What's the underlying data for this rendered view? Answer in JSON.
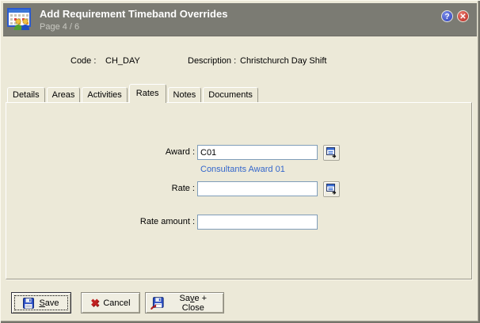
{
  "window": {
    "title": "Add Requirement Timeband Overrides",
    "subtitle": "Page 4 / 6",
    "help_glyph": "?",
    "close_glyph": "✕"
  },
  "header_fields": {
    "code_label": "Code :",
    "code_value": "CH_DAY",
    "description_label": "Description :",
    "description_value": "Christchurch Day Shift"
  },
  "tabs": {
    "active": "Rates",
    "items": [
      {
        "label": "Details"
      },
      {
        "label": "Areas"
      },
      {
        "label": "Activities"
      },
      {
        "label": "Rates"
      },
      {
        "label": "Notes"
      },
      {
        "label": "Documents"
      }
    ]
  },
  "form": {
    "award_label": "Award :",
    "award_value": "C01",
    "award_helper": "Consultants Award 01",
    "rate_label": "Rate :",
    "rate_value": "",
    "rate_amount_label": "Rate amount :",
    "rate_amount_value": ""
  },
  "buttons": {
    "save": {
      "pre": "",
      "key": "S",
      "rest": "ave"
    },
    "cancel": {
      "label": "Cancel"
    },
    "save_close": {
      "pre": "Sa",
      "key": "v",
      "rest": "e + Close"
    }
  },
  "colors": {
    "window_bg": "#ECE9D8",
    "titlebar_bg": "#7B7B73",
    "title_text": "#FFFFFF",
    "subtitle_text": "#C9C9C2",
    "link_text": "#3366CC",
    "input_border": "#7F9DB9",
    "help_button": "#2B3EB8",
    "close_button": "#B82820",
    "cancel_x": "#C02020"
  }
}
